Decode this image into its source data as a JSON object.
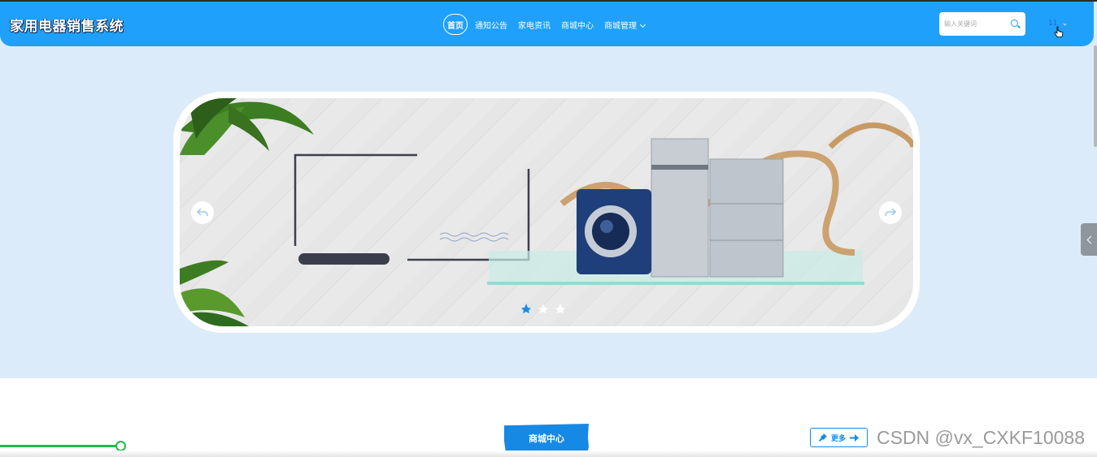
{
  "app": {
    "brand": "家用电器销售系统"
  },
  "nav": {
    "items": [
      {
        "label": "首页",
        "active": true
      },
      {
        "label": "通知公告"
      },
      {
        "label": "家电资讯"
      },
      {
        "label": "商城中心"
      },
      {
        "label": "商城管理",
        "has_dropdown": true
      }
    ]
  },
  "search": {
    "placeholder": "输入关键词",
    "icon": "search-icon"
  },
  "user": {
    "name": "11"
  },
  "carousel": {
    "slides": 3,
    "active_slide": 1
  },
  "section": {
    "title": "商城中心",
    "more_label": "更多"
  },
  "watermark": "CSDN @vx_CXKF10088",
  "colors": {
    "primary": "#1ea0fb",
    "accent": "#1689e4",
    "background": "#dcebfa",
    "progress": "#1dbb50"
  }
}
